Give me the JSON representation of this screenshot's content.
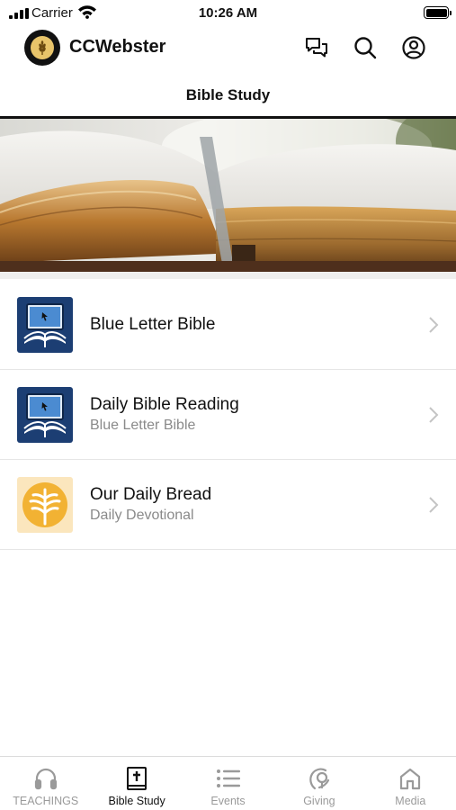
{
  "status_bar": {
    "carrier": "Carrier",
    "time": "10:26 AM"
  },
  "header": {
    "app_name": "CCWebster",
    "icons": [
      "chat-icon",
      "search-icon",
      "profile-icon"
    ]
  },
  "page": {
    "title": "Bible Study"
  },
  "list": {
    "items": [
      {
        "title": "Blue Letter Bible",
        "subtitle": "",
        "icon": "blue-letter-bible-icon"
      },
      {
        "title": "Daily Bible Reading",
        "subtitle": "Blue Letter Bible",
        "icon": "blue-letter-bible-icon"
      },
      {
        "title": "Our Daily Bread",
        "subtitle": "Daily Devotional",
        "icon": "our-daily-bread-icon"
      }
    ]
  },
  "tabs": [
    {
      "label": "TEACHINGS",
      "icon": "headphones-icon",
      "active": false
    },
    {
      "label": "Bible Study",
      "icon": "bible-icon",
      "active": true
    },
    {
      "label": "Events",
      "icon": "list-icon",
      "active": false
    },
    {
      "label": "Giving",
      "icon": "giving-icon",
      "active": false
    },
    {
      "label": "Media",
      "icon": "home-icon",
      "active": false
    }
  ],
  "colors": {
    "active_tab": "#111111",
    "inactive_tab": "#9a9a9a",
    "blb_blue": "#1c3e73",
    "odb_gold": "#f2b233"
  }
}
